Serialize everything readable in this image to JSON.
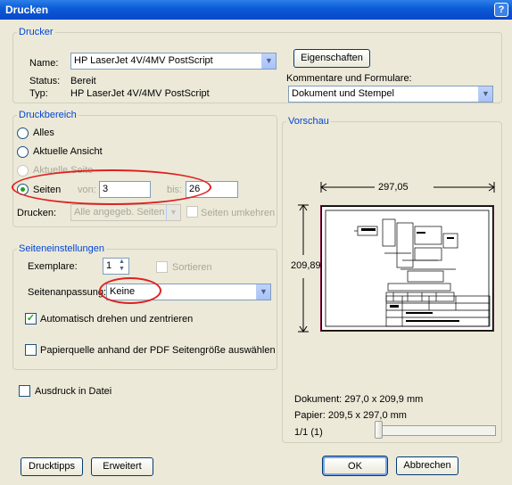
{
  "window": {
    "title": "Drucken",
    "help_glyph": "?"
  },
  "printer": {
    "legend": "Drucker",
    "name_label": "Name:",
    "name_value": "HP LaserJet 4V/4MV PostScript",
    "status_label": "Status:",
    "status_value": "Bereit",
    "type_label": "Typ:",
    "type_value": "HP LaserJet 4V/4MV PostScript",
    "properties_button": "Eigenschaften",
    "comments_label": "Kommentare und Formulare:",
    "comments_value": "Dokument und Stempel"
  },
  "range": {
    "legend": "Druckbereich",
    "all": "Alles",
    "current_view": "Aktuelle Ansicht",
    "current_page": "Aktuelle Seite",
    "pages": "Seiten",
    "from_label": "von:",
    "from_value": "3",
    "to_label": "bis:",
    "to_value": "26",
    "print_label": "Drucken:",
    "print_value": "Alle angegeb. Seiten",
    "reverse_pages": "Seiten umkehren",
    "selected": "pages"
  },
  "setup": {
    "legend": "Seiteneinstellungen",
    "copies_label": "Exemplare:",
    "copies_value": "1",
    "collate": "Sortieren",
    "scaling_label": "Seitenanpassung:",
    "scaling_value": "Keine",
    "auto_rotate": "Automatisch drehen und zentrieren",
    "auto_rotate_checked": true,
    "paper_source": "Papierquelle anhand der PDF Seitengröße auswählen",
    "paper_source_checked": false
  },
  "print_to_file": {
    "label": "Ausdruck in Datei",
    "checked": false
  },
  "preview": {
    "legend": "Vorschau",
    "width_dim": "297,05",
    "height_dim": "209,89",
    "document_info": "Dokument: 297,0 x 209,9 mm",
    "paper_info": "Papier: 209,5 x 297,0 mm",
    "page_info": "1/1 (1)",
    "page_slider_position": 0
  },
  "buttons": {
    "tips": "Drucktipps",
    "advanced": "Erweitert",
    "ok": "OK",
    "cancel": "Abbrechen"
  },
  "colors": {
    "legend_blue": "#0046d5",
    "annotation_red": "#e02020",
    "titlebar_blue": "#0a5ad6",
    "dialog_bg": "#ece9d8"
  }
}
